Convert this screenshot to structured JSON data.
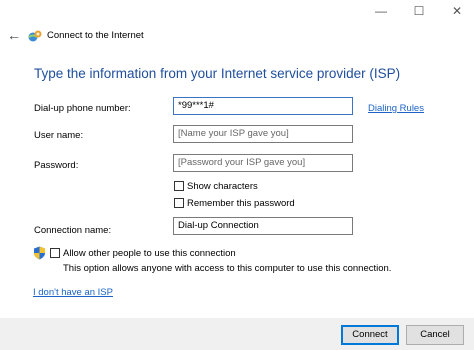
{
  "window": {
    "minimize_glyph": "—",
    "maximize_glyph": "☐",
    "close_glyph": "✕"
  },
  "nav": {
    "back_glyph": "←",
    "title": "Connect to the Internet"
  },
  "form": {
    "heading": "Type the information from your Internet service provider (ISP)",
    "phone": {
      "label": "Dial-up phone number:",
      "value": "*99***1#"
    },
    "dialing_rules": "Dialing Rules",
    "username": {
      "label": "User name:",
      "placeholder": "[Name your ISP gave you]"
    },
    "password": {
      "label": "Password:",
      "placeholder": "[Password your ISP gave you]"
    },
    "show_characters": {
      "label": "Show characters",
      "checked": false
    },
    "remember_password": {
      "label": "Remember this password",
      "checked": false
    },
    "connection_name": {
      "label": "Connection name:",
      "value": "Dial-up Connection"
    },
    "allow_others": {
      "label": "Allow other people to use this connection",
      "checked": false
    },
    "allow_note": "This option allows anyone with access to this computer to use this connection.",
    "no_isp_link": "I don't have an ISP"
  },
  "buttons": {
    "connect": "Connect",
    "cancel": "Cancel"
  },
  "colors": {
    "heading": "#1f4e9c",
    "link": "#1b63c6",
    "focus": "#0078d7",
    "footer": "#f0f0f0"
  }
}
